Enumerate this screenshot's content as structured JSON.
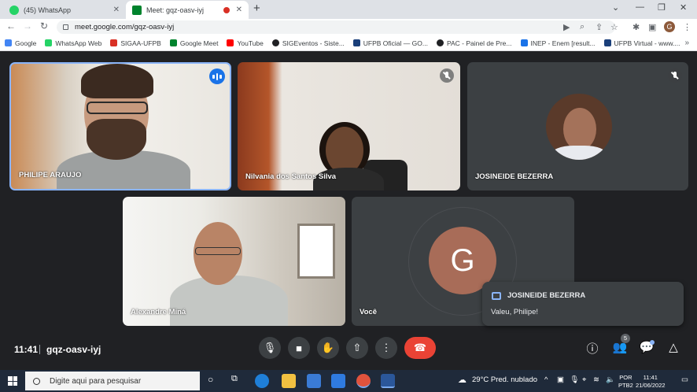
{
  "browser": {
    "tabs": [
      {
        "label": "(45) WhatsApp",
        "active": false
      },
      {
        "label": "Meet: gqz-oasv-iyj",
        "active": true
      }
    ],
    "new_tab": "+",
    "address": "meet.google.com/gqz-oasv-iyj",
    "profile_initial": "G",
    "bookmarks": [
      {
        "label": "Google",
        "color": "#4285f4"
      },
      {
        "label": "WhatsApp Web",
        "color": "#25d366"
      },
      {
        "label": "SIGAA-UFPB",
        "color": "#d93025"
      },
      {
        "label": "Google Meet",
        "color": "#00832d"
      },
      {
        "label": "YouTube",
        "color": "#ff0000"
      },
      {
        "label": "SIGEventos - Siste...",
        "color": "#202124"
      },
      {
        "label": "UFPB Oficial — GO...",
        "color": "#1a3f7a"
      },
      {
        "label": "PAC - Painel de Pre...",
        "color": "#202124"
      },
      {
        "label": "INEP - Enem [result...",
        "color": "#1a73e8"
      },
      {
        "label": "UFPB Virtual - www....",
        "color": "#1a3f7a"
      }
    ]
  },
  "meet": {
    "participants": [
      {
        "name": "PHILIPE ARAUJO",
        "speaking": true
      },
      {
        "name": "Nilvania dos Santos Silva",
        "muted": true
      },
      {
        "name": "JOSINEIDE BEZERRA",
        "muted": true
      },
      {
        "name": "Alexandre Miná"
      },
      {
        "name": "Você",
        "avatar_initial": "G"
      }
    ],
    "chat_notification": {
      "sender": "JOSINEIDE BEZERRA",
      "message": "Valeu, Philipe!"
    },
    "time": "11:41",
    "meeting_code": "gqz-oasv-iyj",
    "people_count": "5",
    "colors": {
      "end_call": "#ea4335",
      "active_border": "#8ab4f8",
      "avatar": "#a86c58"
    }
  },
  "taskbar": {
    "search_placeholder": "Digite aqui para pesquisar",
    "weather": "29°C  Pred. nublado",
    "language": "POR",
    "layout": "PTB2",
    "time": "11:41",
    "date": "21/06/2022"
  }
}
